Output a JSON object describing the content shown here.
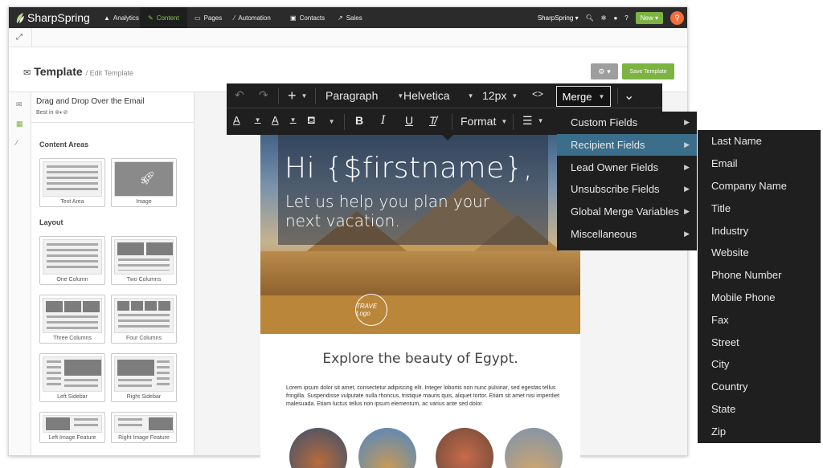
{
  "app": {
    "brand": "SharpSpring",
    "nav": [
      {
        "icon": "chart-icon",
        "label": "Analytics",
        "active": false
      },
      {
        "icon": "pencil-icon",
        "label": "Content",
        "active": true
      },
      {
        "icon": "page-icon",
        "label": "Pages",
        "active": false
      },
      {
        "icon": "wand-icon",
        "label": "Automation",
        "active": false
      },
      {
        "icon": "contact-card-icon",
        "label": "Contacts",
        "active": false
      },
      {
        "icon": "trend-icon",
        "label": "Sales",
        "active": false
      }
    ],
    "account": "SharpSpring",
    "new_label": "New",
    "colors": {
      "nav_bg": "#2b2b2b",
      "accent_green": "#7cb342",
      "pin_orange": "#f26d3d",
      "menu_selected": "#3b6e8a"
    }
  },
  "header": {
    "title": "Template",
    "breadcrumb": "/ Edit Template",
    "save_label": "Save Template"
  },
  "panel": {
    "heading": "Drag and Drop Over the Email",
    "best_in": "Best in",
    "content_areas_title": "Content Areas",
    "content_areas": [
      "Text Area",
      "Image"
    ],
    "layout_title": "Layout",
    "layouts": [
      "One Column",
      "Two Columns",
      "Three Columns",
      "Four Columns",
      "Left Sidebar",
      "Right Sidebar",
      "Left Image Feature",
      "Right Image Feature"
    ]
  },
  "toolbar": {
    "block_format": "Paragraph",
    "font": "Helvetica",
    "size": "12px",
    "code_icon": "<>",
    "format_label": "Format",
    "merge_label": "Merge"
  },
  "merge_menu": {
    "items": [
      "Custom Fields",
      "Recipient Fields",
      "Lead Owner Fields",
      "Unsubscribe Fields",
      "Global Merge Variables",
      "Miscellaneous"
    ],
    "selected": "Recipient Fields"
  },
  "recipient_fields": [
    "Last Name",
    "Email",
    "Company Name",
    "Title",
    "Industry",
    "Website",
    "Phone Number",
    "Mobile Phone",
    "Fax",
    "Street",
    "City",
    "Country",
    "State",
    "Zip"
  ],
  "email": {
    "greeting": "Hi {$firstname},",
    "subheading": "Let us help you plan your next vacation.",
    "logo_text": "TRAVE Logo",
    "section_title": "Explore the beauty of Egypt.",
    "body": "Lorem ipsum dolor sit amet, consectetur adipiscing elit. Integer lobortis non nunc pulvinar, sed egestas tellus fringilla. Suspendisse vulputate nulla rhoncus, tristique mauris quis, aliquet tortor. Etiam sit amet nisi imperdiet malesuada. Etiam luctus tellus non ipsum elementum, ac varius ante sed dolor."
  }
}
